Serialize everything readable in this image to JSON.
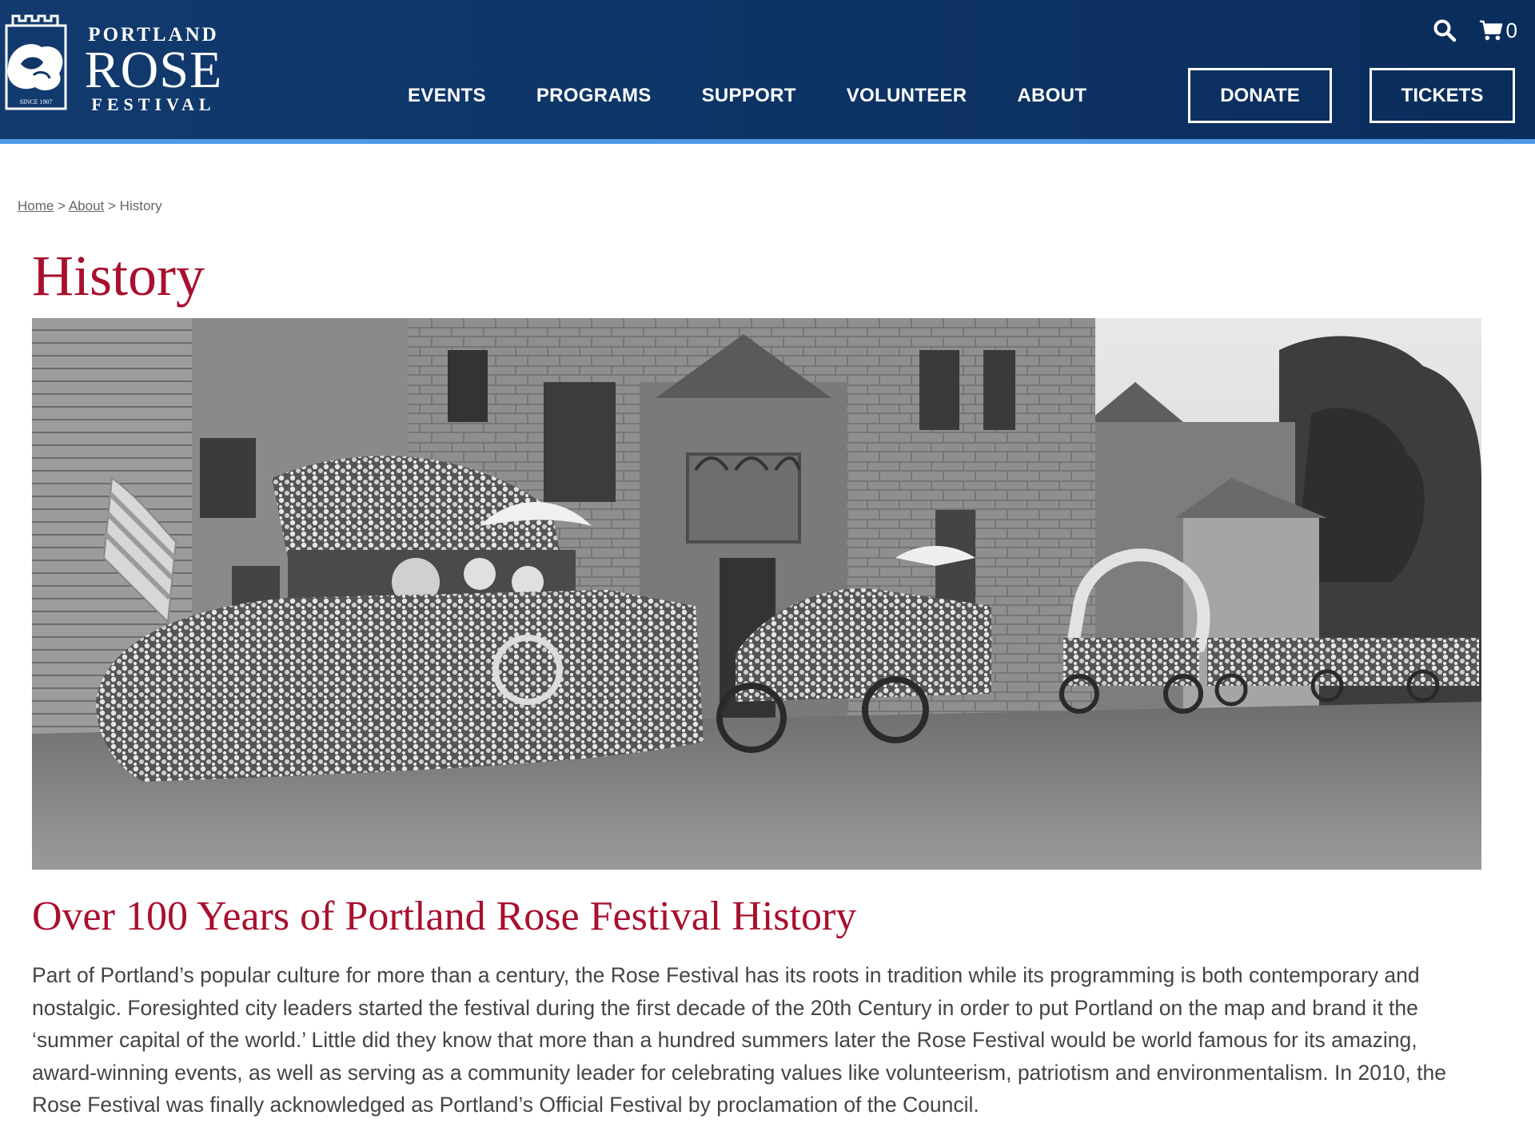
{
  "brand": {
    "portland": "PORTLAND",
    "rose": "ROSE",
    "festival": "FESTIVAL",
    "since": "SINCE 1907"
  },
  "utility": {
    "search_icon": "search-icon",
    "cart_icon": "cart-icon",
    "cart_count": "0"
  },
  "nav": {
    "items": [
      "EVENTS",
      "PROGRAMS",
      "SUPPORT",
      "VOLUNTEER",
      "ABOUT"
    ],
    "donate": "DONATE",
    "tickets": "TICKETS"
  },
  "colors": {
    "header_bg": "#0e3567",
    "header_accent": "#4f9ae6",
    "title_red": "#a8102e"
  },
  "breadcrumb": {
    "home": "Home",
    "about": "About",
    "current": "History",
    "separator": ">"
  },
  "page": {
    "title": "History",
    "heading": "Over 100 Years of Portland Rose Festival History",
    "body": "Part of Portland’s popular culture for more than a century, the Rose Festival has its roots in tradition while its programming is both contemporary and nostalgic. Foresighted city leaders started the festival during the first decade of the 20th Century in order to put Portland on the map and brand it the ‘summer capital of the world.’ Little did they know that more than a hundred summers later the Rose Festival would be world famous for its amazing, award-winning events, as well as serving as a community leader for celebrating values like volunteerism, patriotism and environmentalism. In 2010, the Rose Festival was finally acknowledged as Portland’s Official Festival by proclamation of the Council."
  }
}
